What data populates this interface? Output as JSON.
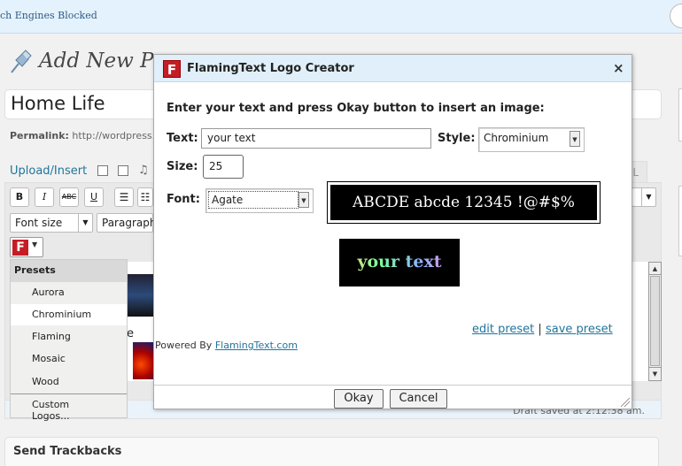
{
  "background": {
    "topbar_text": "ch Engines Blocked",
    "page_title": "Add New Pos",
    "post_title": "Home Life",
    "permalink_label": "Permalink:",
    "permalink_value": "http://wordpress.",
    "upload_insert": "Upload/Insert",
    "html_tab": "ML",
    "font_size_select": "Font size",
    "paragraph_select": "Paragraph",
    "editor_fragment": "e",
    "draft_saved": "Draft saved at 2:12:38 am.",
    "send_trackbacks": "Send Trackbacks"
  },
  "toolbar": {
    "bold": "B",
    "italic": "I",
    "strike": "ABC",
    "underline": "U"
  },
  "flamingtext_button": {
    "icon_letter": "F"
  },
  "presets_menu": {
    "header": "Presets",
    "items": [
      "Aurora",
      "Chrominium",
      "Flaming",
      "Mosaic",
      "Wood"
    ],
    "selected": "Chrominium",
    "custom": "Custom Logos..."
  },
  "dialog": {
    "icon_letter": "F",
    "title": "FlamingText Logo Creator",
    "close": "×",
    "instruction": "Enter your text and press Okay button to insert an image:",
    "text_label": "Text:",
    "text_value": "your text",
    "style_label": "Style:",
    "style_value": "Chrominium",
    "size_label": "Size:",
    "size_value": "25",
    "font_label": "Font:",
    "font_value": "Agate",
    "font_preview": "ABCDE abcde 12345 !@#$%",
    "logo_preview": "your text",
    "edit_preset": "edit preset",
    "separator": "|",
    "save_preset": "save preset",
    "powered_by": "Powered By",
    "powered_link": "FlamingText.com",
    "okay": "Okay",
    "cancel": "Cancel"
  },
  "colors": {
    "link": "#21759b",
    "title_bar": "#e0eff9",
    "flamingtext_red": "#c41d26"
  }
}
